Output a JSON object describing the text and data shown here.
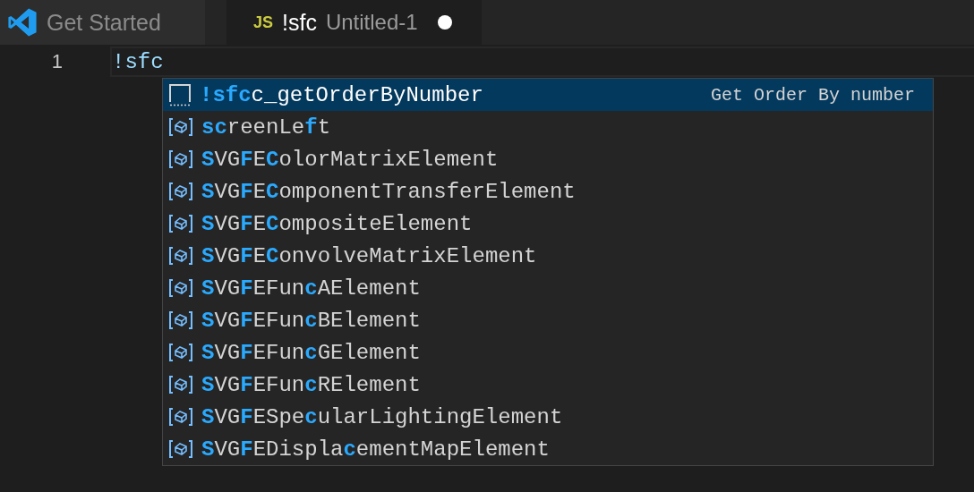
{
  "tabs": [
    {
      "label": "Get Started",
      "selected": false,
      "kind": "welcome"
    },
    {
      "badge": "JS",
      "label": "!sfc",
      "description": "Untitled-1",
      "selected": true,
      "dirty": true,
      "kind": "file"
    }
  ],
  "editor": {
    "line_number": "1",
    "code": "!sfc"
  },
  "suggestions": [
    {
      "kind": "snippet",
      "label": "**!sfc**c_getOrderByNumber",
      "detail": "Get Order By number",
      "selected": true
    },
    {
      "kind": "property",
      "label": "**sc**reenLe**f**t",
      "selected": false
    },
    {
      "kind": "property",
      "label": "**S**VG**F**E**C**olorMatrixElement",
      "selected": false
    },
    {
      "kind": "property",
      "label": "**S**VG**F**E**C**omponentTransferElement",
      "selected": false
    },
    {
      "kind": "property",
      "label": "**S**VG**F**E**C**ompositeElement",
      "selected": false
    },
    {
      "kind": "property",
      "label": "**S**VG**F**E**C**onvolveMatrixElement",
      "selected": false
    },
    {
      "kind": "property",
      "label": "**S**VG**F**EFun**c**AElement",
      "selected": false
    },
    {
      "kind": "property",
      "label": "**S**VG**F**EFun**c**BElement",
      "selected": false
    },
    {
      "kind": "property",
      "label": "**S**VG**F**EFun**c**GElement",
      "selected": false
    },
    {
      "kind": "property",
      "label": "**S**VG**F**EFun**c**RElement",
      "selected": false
    },
    {
      "kind": "property",
      "label": "**S**VG**F**ESpe**c**ularLightingElement",
      "selected": false
    },
    {
      "kind": "property",
      "label": "**S**VG**F**EDispla**c**ementMapElement",
      "selected": false
    }
  ]
}
